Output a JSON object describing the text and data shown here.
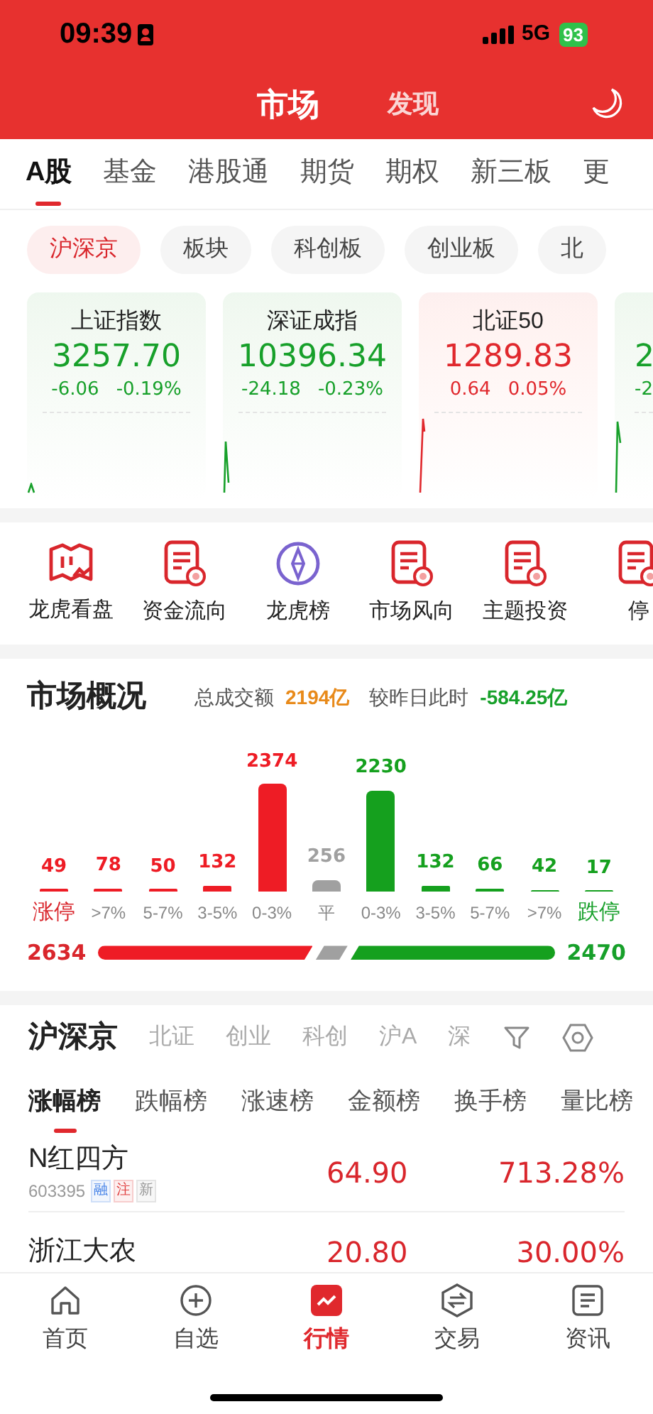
{
  "status_bar": {
    "time": "09:39",
    "network": "5G",
    "battery": "93"
  },
  "header": {
    "tabs": [
      {
        "label": "市场",
        "selected": true
      },
      {
        "label": "发现",
        "selected": false
      }
    ]
  },
  "market_tabs": [
    {
      "label": "A股",
      "selected": true
    },
    {
      "label": "基金",
      "selected": false
    },
    {
      "label": "港股通",
      "selected": false
    },
    {
      "label": "期货",
      "selected": false
    },
    {
      "label": "期权",
      "selected": false
    },
    {
      "label": "新三板",
      "selected": false
    },
    {
      "label": "更",
      "selected": false
    }
  ],
  "chips": [
    {
      "label": "沪深京",
      "selected": true
    },
    {
      "label": "板块",
      "selected": false
    },
    {
      "label": "科创板",
      "selected": false
    },
    {
      "label": "创业板",
      "selected": false
    },
    {
      "label": "北",
      "selected": false
    }
  ],
  "index_cards": [
    {
      "name": "上证指数",
      "value": "3257.70",
      "change": "-6.06",
      "percent": "-0.19%",
      "color": "#17a02a"
    },
    {
      "name": "深证成指",
      "value": "10396.34",
      "change": "-24.18",
      "percent": "-0.23%",
      "color": "#17a02a"
    },
    {
      "name": "北证50",
      "value": "1289.83",
      "change": "0.64",
      "percent": "0.05%",
      "color": "#e0282d"
    },
    {
      "value": "2",
      "change": "-2",
      "color": "#17a02a"
    }
  ],
  "shortcuts": [
    {
      "label": "龙虎看盘",
      "kind": "map"
    },
    {
      "label": "资金流向",
      "kind": "report"
    },
    {
      "label": "龙虎榜",
      "kind": "compass"
    },
    {
      "label": "市场风向",
      "kind": "report"
    },
    {
      "label": "主题投资",
      "kind": "report"
    },
    {
      "label": "停",
      "kind": "report"
    }
  ],
  "overview": {
    "title": "市场概况",
    "turnover_label": "总成交额",
    "turnover": "2194亿",
    "compare_label": "较昨日此时",
    "compare": "-584.25亿",
    "chart_data": {
      "type": "bar",
      "data_labels": true,
      "categories": [
        "涨停",
        ">7%",
        "5-7%",
        "3-5%",
        "0-3%",
        "平",
        "0-3%",
        "3-5%",
        "5-7%",
        ">7%",
        "跌停"
      ],
      "values": [
        49,
        78,
        50,
        132,
        2374,
        256,
        2230,
        132,
        66,
        42,
        17
      ]
    },
    "ratio_bar": {
      "up": "2634",
      "down": "2470",
      "level": 0.47
    }
  },
  "ranking": {
    "scopes": [
      {
        "label": "沪深京",
        "selected": true
      },
      {
        "label": "北证",
        "selected": false
      },
      {
        "label": "创业",
        "selected": false
      },
      {
        "label": "科创",
        "selected": false
      },
      {
        "label": "沪A",
        "selected": false
      },
      {
        "label": "深",
        "selected": false
      }
    ],
    "tabs": [
      {
        "label": "涨幅榜",
        "selected": true
      },
      {
        "label": "跌幅榜",
        "selected": false
      },
      {
        "label": "涨速榜",
        "selected": false
      },
      {
        "label": "金额榜",
        "selected": false
      },
      {
        "label": "换手榜",
        "selected": false
      },
      {
        "label": "量比榜",
        "selected": false
      }
    ],
    "rows": [
      {
        "name": "N红四方",
        "code": "603395",
        "tags": [
          {
            "text": "融",
            "color": "#4a86e8"
          },
          {
            "text": "注",
            "color": "#e04040"
          },
          {
            "text": "新",
            "color": "#9a9a9a"
          }
        ],
        "price": "64.90",
        "change": "713.28%"
      },
      {
        "name": "浙江大农",
        "price": "20.80",
        "change": "30.00%"
      }
    ]
  },
  "bottom_nav": [
    {
      "label": "首页",
      "kind": "home",
      "selected": false
    },
    {
      "label": "自选",
      "kind": "plus",
      "selected": false
    },
    {
      "label": "行情",
      "kind": "chart",
      "selected": true
    },
    {
      "label": "交易",
      "kind": "exchange",
      "selected": false
    },
    {
      "label": "资讯",
      "kind": "news",
      "selected": false
    }
  ]
}
